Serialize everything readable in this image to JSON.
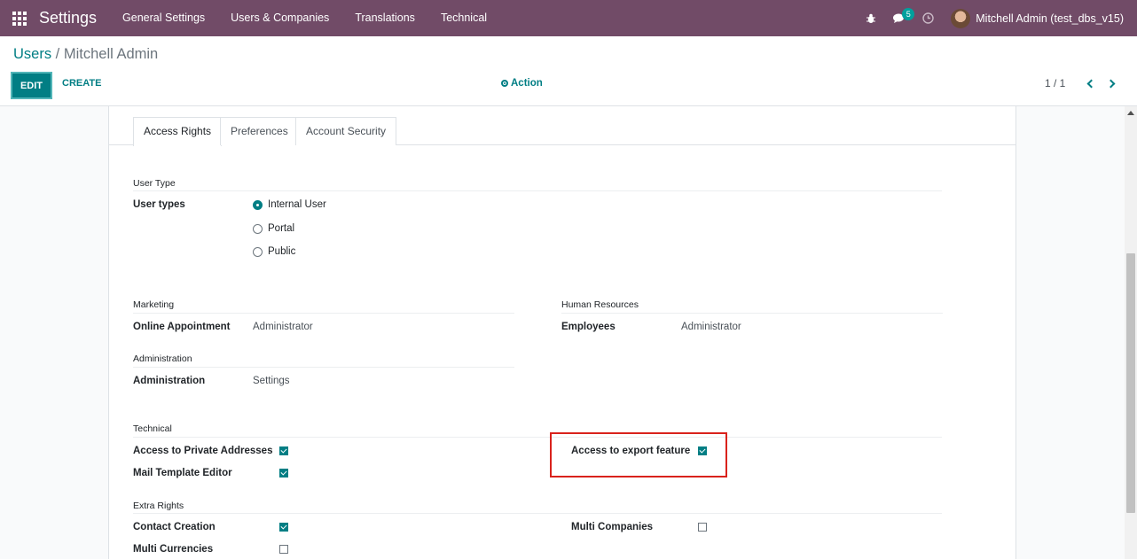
{
  "navbar": {
    "brand": "Settings",
    "menu": [
      "General Settings",
      "Users & Companies",
      "Translations",
      "Technical"
    ],
    "messages_count": "5",
    "user_name": "Mitchell Admin (test_dbs_v15)"
  },
  "control_panel": {
    "breadcrumb_parent": "Users",
    "breadcrumb_sep": " / ",
    "breadcrumb_current": "Mitchell Admin",
    "edit_label": "EDIT",
    "create_label": "CREATE",
    "action_label": "Action",
    "pager": "1 / 1"
  },
  "tabs": [
    "Access Rights",
    "Preferences",
    "Account Security"
  ],
  "user_type": {
    "group": "User Type",
    "label": "User types",
    "options": [
      "Internal User",
      "Portal",
      "Public"
    ],
    "selected": "Internal User"
  },
  "marketing": {
    "group": "Marketing",
    "label": "Online Appointment",
    "value": "Administrator"
  },
  "human_resources": {
    "group": "Human Resources",
    "label": "Employees",
    "value": "Administrator"
  },
  "administration": {
    "group": "Administration",
    "label": "Administration",
    "value": "Settings"
  },
  "technical": {
    "group": "Technical",
    "private_addresses": "Access to Private Addresses",
    "mail_template": "Mail Template Editor",
    "export_feature": "Access to export feature"
  },
  "extra_rights": {
    "group": "Extra Rights",
    "contact_creation": "Contact Creation",
    "multi_companies": "Multi Companies",
    "multi_currencies": "Multi Currencies"
  },
  "colors": {
    "navbar": "#714b67",
    "accent": "#017e84",
    "highlight": "#d9221c"
  }
}
